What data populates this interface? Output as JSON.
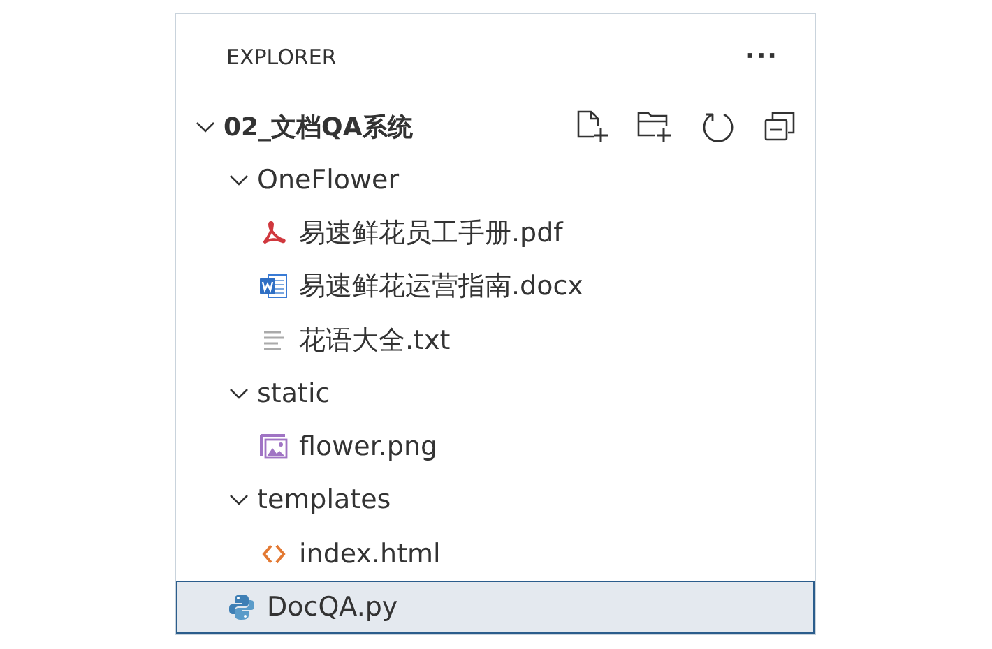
{
  "panel": {
    "title": "EXPLORER",
    "more": "···"
  },
  "workspace": {
    "name": "02_文档QA系统",
    "expanded": true,
    "children": [
      {
        "name": "OneFlower",
        "kind": "folder",
        "expanded": true,
        "selected": false,
        "children": [
          {
            "name": "易速鲜花员工手册.pdf",
            "kind": "pdf",
            "selected": false
          },
          {
            "name": "易速鲜花运营指南.docx",
            "kind": "word",
            "selected": false
          },
          {
            "name": "花语大全.txt",
            "kind": "text",
            "selected": false
          }
        ]
      },
      {
        "name": "static",
        "kind": "folder",
        "expanded": true,
        "selected": false,
        "children": [
          {
            "name": "flower.png",
            "kind": "image",
            "selected": false
          }
        ]
      },
      {
        "name": "templates",
        "kind": "folder",
        "expanded": true,
        "selected": false,
        "children": [
          {
            "name": "index.html",
            "kind": "html",
            "selected": false
          }
        ]
      },
      {
        "name": "DocQA.py",
        "kind": "python",
        "selected": true
      }
    ]
  }
}
